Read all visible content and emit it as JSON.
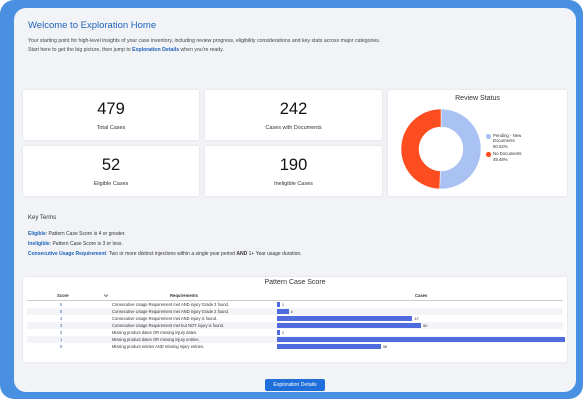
{
  "page": {
    "title": "Welcome to Exploration Home",
    "intro_line1": "Your starting point for high-level insights of your case inventory, including review progress, eligibility considerations and key stats across major categories.",
    "intro_line2_prefix": "Start here to get the big picture, then jump to ",
    "intro_line2_link": "Exploration Details",
    "intro_line2_suffix": " when you're ready."
  },
  "stats": {
    "total_cases_value": "479",
    "total_cases_label": "Total Cases",
    "cases_with_docs_value": "242",
    "cases_with_docs_label": "Cases with Documents",
    "eligible_value": "52",
    "eligible_label": "Eligible Cases",
    "ineligible_value": "190",
    "ineligible_label": "Ineligible Cases"
  },
  "review_status": {
    "title": "Review Status",
    "slices": [
      {
        "label": "Pending - New Documents",
        "label_line1": "Pending - New",
        "label_line2": "Documents",
        "percent_text": "50.52%",
        "value": 50.52,
        "color": "#a9c2f3"
      },
      {
        "label": "No Documents",
        "percent_text": "49.48%",
        "value": 49.48,
        "color": "#fb4d20"
      }
    ]
  },
  "key_terms": {
    "title": "Key Terms",
    "eligible_term": "Eligible",
    "eligible_def": ": Pattern Case Score is 4 or greater.",
    "ineligible_term": "Ineligible",
    "ineligible_def": ": Pattern Case Score is 3 or less.",
    "usage_term": "Consecutive Usage Requirement",
    "usage_def_a": ": Two or more distinct injections within a single year period ",
    "usage_def_and": "AND",
    "usage_def_b": " 1+ Year usage duration."
  },
  "pattern_case_score": {
    "title": "Pattern Case Score",
    "columns": {
      "score": "Score",
      "requirements": "Requirements",
      "cases": "Cases"
    },
    "sort_icon": "chevron-down-icon",
    "max_cases": 100,
    "rows": [
      {
        "score": "6",
        "requirement": "Consecutive Usage Requirement met AND injury Grade 3 found.",
        "cases": 1
      },
      {
        "score": "5",
        "requirement": "Consecutive Usage Requirement met AND injury Grade 2 found.",
        "cases": 4
      },
      {
        "score": "4",
        "requirement": "Consecutive Usage Requirement met AND injury is found.",
        "cases": 47
      },
      {
        "score": "3",
        "requirement": "Consecutive Usage Requirement met but NOT injury is found.",
        "cases": 50
      },
      {
        "score": "2",
        "requirement": "Missing product dates OR missing injury dates.",
        "cases": 1
      },
      {
        "score": "1",
        "requirement": "Missing product dates OR missing injury entries.",
        "cases": 100
      },
      {
        "score": "0",
        "requirement": "Missing product entries AND missing injury entries.",
        "cases": 36
      }
    ]
  },
  "cta": {
    "label": "Exploration Details"
  }
}
